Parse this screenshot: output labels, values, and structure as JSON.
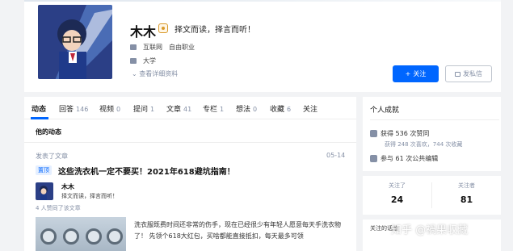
{
  "profile": {
    "name": "木木",
    "headline": "择文而读，择言而听！",
    "industry": "互联网",
    "occupation": "自由职业",
    "education": "大学",
    "detail_link": "查看详细资料",
    "follow_label": "关注",
    "message_label": "发私信"
  },
  "tabs": [
    {
      "label": "动态",
      "count": ""
    },
    {
      "label": "回答",
      "count": "146"
    },
    {
      "label": "视频",
      "count": "0"
    },
    {
      "label": "提问",
      "count": "1"
    },
    {
      "label": "文章",
      "count": "41"
    },
    {
      "label": "专栏",
      "count": "1"
    },
    {
      "label": "想法",
      "count": "0"
    },
    {
      "label": "收藏",
      "count": "6"
    },
    {
      "label": "关注",
      "count": ""
    }
  ],
  "feed": {
    "section_title": "他的动态",
    "activity_label": "发表了文章",
    "activity_time": "05-14",
    "tag": "置顶",
    "article_title": "这些洗衣机一定不要买！2021年618避坑指南！",
    "author_name": "木木",
    "author_headline": "择文而读，择言而听！",
    "upvote_line": "4 人赞同了该文章",
    "excerpt": "洗衣服既费时间还非常的伤手，现在已经很少有年轻人愿意每天手洗衣物了！ 先领个618大红包，买啥都能直接抵扣，每天最多可领"
  },
  "achievements": {
    "title": "个人成就",
    "upvotes": "获得 536 次赞同",
    "upvotes_sub": "获得 248 次喜欢，744 次收藏",
    "edits": "参与 61 次公共编辑"
  },
  "follows": {
    "following_label": "关注了",
    "following_count": "24",
    "followers_label": "关注者",
    "followers_count": "81"
  },
  "side3": {
    "title": "关注的话题"
  },
  "watermark": "知乎 @禍果収藏",
  "colors": {
    "accent": "#0066ff",
    "muted": "#8590a6",
    "page_bg": "#f2f3f5"
  }
}
